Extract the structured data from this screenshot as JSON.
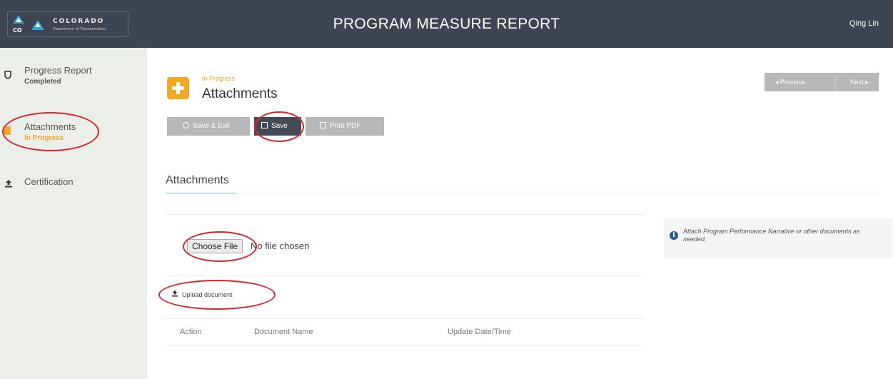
{
  "header": {
    "logo": {
      "brand": "COLORADO",
      "subtitle": "Department of Transportation",
      "badge": "CDOT",
      "monogram": "CO"
    },
    "title": "PROGRAM MEASURE REPORT",
    "user": "Qing Lin"
  },
  "sidebar": {
    "steps": [
      {
        "title": "Progress Report",
        "status": "Completed",
        "icon": "shield-icon"
      },
      {
        "title": "Attachments",
        "status": "In Progress",
        "icon": "document-icon"
      },
      {
        "title": "Certification",
        "status": "",
        "icon": "upload-icon"
      }
    ]
  },
  "page": {
    "status": "In Progress",
    "title": "Attachments",
    "status_icon": "plus-icon",
    "accent": "#f2a727"
  },
  "pager": {
    "previous": "◂ Previous",
    "next": "Next ▸"
  },
  "toolbar": {
    "save_exit": "Save & Exit",
    "save": "Save",
    "print_pdf": "Print PDF"
  },
  "section": {
    "title": "Attachments"
  },
  "file_input": {
    "button": "Choose File",
    "status": "No file chosen"
  },
  "upload": {
    "label": "Upload document",
    "icon": "upload-icon"
  },
  "table": {
    "columns": [
      "Action",
      "Document Name",
      "Update Date/Time"
    ]
  },
  "info": {
    "text": "Attach Program Performance Narrative or other documents as needed."
  },
  "colors": {
    "header_bg": "#3e4451",
    "sidebar_bg": "#eceee9",
    "annotation": "#d9262b"
  }
}
